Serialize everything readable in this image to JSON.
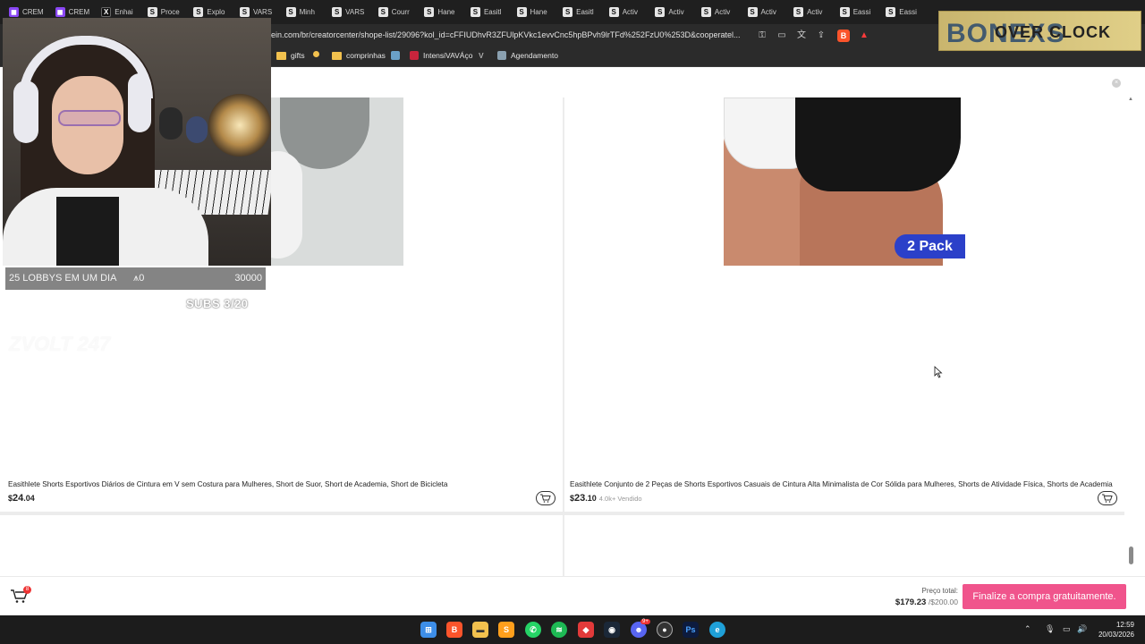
{
  "browser": {
    "tabs": [
      {
        "label": "CREM",
        "icon": "twitch-icon"
      },
      {
        "label": "CREM",
        "icon": "twitch-icon"
      },
      {
        "label": "Enhai",
        "icon": "x-icon"
      },
      {
        "label": "Proce",
        "icon": "s-icon"
      },
      {
        "label": "Explo",
        "icon": "s-icon"
      },
      {
        "label": "VARS",
        "icon": "s-icon"
      },
      {
        "label": "Minh",
        "icon": "s-icon"
      },
      {
        "label": "VARS",
        "icon": "s-icon"
      },
      {
        "label": "Courr",
        "icon": "s-icon"
      },
      {
        "label": "Hane",
        "icon": "s-icon"
      },
      {
        "label": "Easitl",
        "icon": "s-icon"
      },
      {
        "label": "Hane",
        "icon": "s-icon"
      },
      {
        "label": "Easitl",
        "icon": "s-icon"
      },
      {
        "label": "Activ",
        "icon": "s-icon"
      },
      {
        "label": "Activ",
        "icon": "s-icon"
      },
      {
        "label": "Activ",
        "icon": "s-icon"
      },
      {
        "label": "Activ",
        "icon": "s-icon"
      },
      {
        "label": "Activ",
        "icon": "s-icon"
      },
      {
        "label": "Eassi",
        "icon": "s-icon"
      },
      {
        "label": "Eassi",
        "icon": "s-icon"
      }
    ],
    "url": "ein.com/br/creatorcenter/shope-list/29096?kol_id=cFFIUDhvR3ZFUlpKVkc1evvCnc5hpBPvh9lrTFd%252FzU0%253D&cooperatel...",
    "bookmarks": [
      {
        "label": "gifts",
        "icon": "folder-icon"
      },
      {
        "label": "",
        "icon": "dot-icon"
      },
      {
        "label": "comprinhas",
        "icon": "folder-icon"
      },
      {
        "label": "",
        "icon": "image-icon"
      },
      {
        "label": "IntensiVAVÁço",
        "icon": "valorant-icon"
      },
      {
        "label": "",
        "icon": "v-icon"
      },
      {
        "label": "Agendamento",
        "icon": "calendar-icon"
      }
    ]
  },
  "products": [
    {
      "title": "Easithlete Shorts Esportivos Diários de Cintura em V sem Costura para Mulheres, Short de Suor, Short de Academia, Short de Bicicleta",
      "currency": "$",
      "price_main": "24",
      "price_cents": ".04",
      "sold": ""
    },
    {
      "title": "Easithlete Conjunto de 2 Peças de Shorts Esportivos Casuais de Cintura Alta Minimalista de Cor Sólida para Mulheres, Shorts de Atividade Física, Shorts de Academia",
      "currency": "$",
      "price_main": "23",
      "price_cents": ".10",
      "sold": "4.0k+ Vendido",
      "badge": "2 Pack"
    }
  ],
  "checkout": {
    "cart_count": "8",
    "total_label": "Preço total:",
    "total_value": "$179.23",
    "total_limit": "/$200.00",
    "button": "Finalize a compra gratuitamente."
  },
  "stream": {
    "goal_text": "25 LOBBYS EM UM DIA",
    "goal_count": "0",
    "goal_target": "30000",
    "subs": "SUBS 3/20",
    "ghost_text": "ZVOLT 247",
    "logo_main": "BONEXS",
    "logo_over": "OVER CLOCK"
  },
  "taskbar": {
    "time": "12:59",
    "date": "20/03/2026",
    "notif_badge": "9+"
  },
  "colors": {
    "accent": "#f0548c",
    "badge_blue": "#2b40c9",
    "twitch": "#8a47f5"
  }
}
